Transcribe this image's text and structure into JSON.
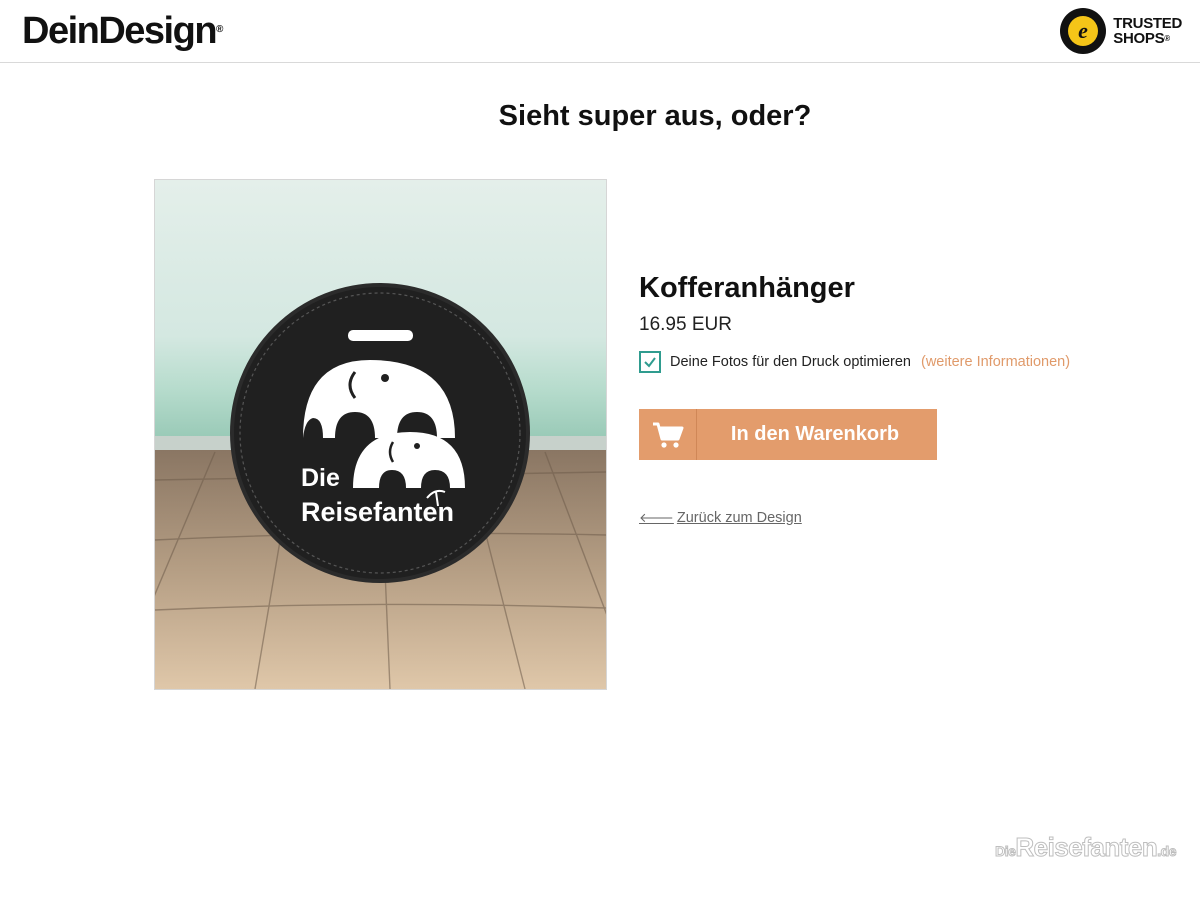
{
  "header": {
    "logo_text": "DeinDesign",
    "logo_mark": "®",
    "trusted_line1": "TRUSTED",
    "trusted_line2": "SHOPS",
    "trusted_mark": "®",
    "seal_letter": "e"
  },
  "main": {
    "title": "Sieht super aus, oder?"
  },
  "product": {
    "name": "Kofferanhänger",
    "price": "16.95 EUR",
    "image_text_line1": "Die",
    "image_text_line2": "Reisefanten",
    "optimize_label": "Deine Fotos für den Druck optimieren",
    "optimize_checked": true,
    "more_info_link": "(weitere Informationen)",
    "cart_button": "In den Warenkorb",
    "back_link": "Zurück zum Design"
  },
  "watermark": {
    "prefix": "Die",
    "name": "Reisefanten",
    "suffix": ".de"
  },
  "colors": {
    "accent": "#e39c6c",
    "checkbox": "#2f9c8f",
    "link": "#e09a6a"
  }
}
